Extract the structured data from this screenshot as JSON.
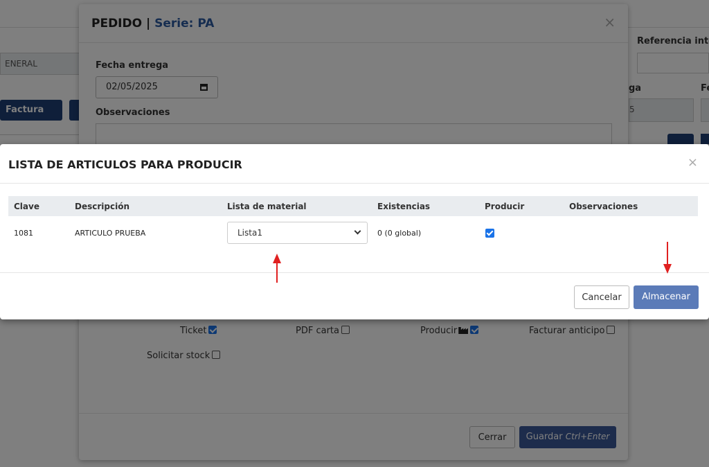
{
  "background": {
    "tab_label": "ENERAL",
    "factura_button": "Factura",
    "referencia_label": "Referencia inte",
    "ga_label": "ga",
    "fe_label": "Fe",
    "date_fragment": "5"
  },
  "pedido": {
    "title_prefix": "PEDIDO | ",
    "title_serie": "Serie: PA",
    "close": "×",
    "fecha_entrega_label": "Fecha entrega",
    "fecha_entrega_value": "02/05/2025",
    "observaciones_label": "Observaciones",
    "checks": {
      "ticket": "Ticket",
      "pdf_carta": "PDF carta",
      "producir": "Producir",
      "facturar_anticipo": "Facturar anticipo",
      "solicitar_stock": "Solicitar stock"
    },
    "cerrar_button": "Cerrar",
    "guardar_button": "Guardar",
    "guardar_shortcut": "Ctrl+Enter"
  },
  "lista": {
    "title": "LISTA DE ARTICULOS PARA PRODUCIR",
    "close": "×",
    "columns": {
      "clave": "Clave",
      "descripcion": "Descripción",
      "lista_material": "Lista de material",
      "existencias": "Existencias",
      "producir": "Producir",
      "observaciones": "Observaciones"
    },
    "rows": [
      {
        "clave": "1081",
        "descripcion": "ARTICULO PRUEBA",
        "lista_material": "Lista1",
        "existencias": "0 (0 global)",
        "producir": true,
        "observaciones": ""
      }
    ],
    "cancelar_button": "Cancelar",
    "almacenar_button": "Almacenar"
  },
  "colors": {
    "primary": "#3b5998",
    "almacenar": "#5b7bb8",
    "arrow": "#e02020",
    "checkbox": "#1a73e8"
  }
}
